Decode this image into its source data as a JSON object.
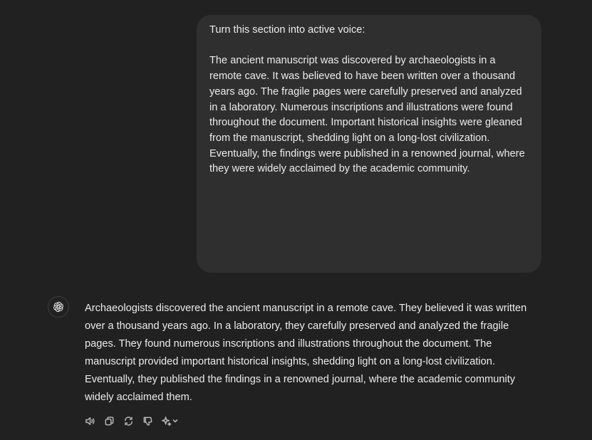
{
  "user_message": {
    "intro": "Turn this section into active voice:",
    "body": "The ancient manuscript was discovered by archaeologists in a remote cave. It was believed to have been written over a thousand years ago. The fragile pages were carefully preserved and analyzed in a laboratory. Numerous inscriptions and illustrations were found throughout the document. Important historical insights were gleaned from the manuscript, shedding light on a long-lost civilization. Eventually, the findings were published in a renowned journal, where they were widely acclaimed by the academic community."
  },
  "assistant_message": {
    "avatar_icon": "openai-logo-icon",
    "body": "Archaeologists discovered the ancient manuscript in a remote cave. They believed it was written over a thousand years ago. In a laboratory, they carefully preserved and analyzed the fragile pages. They found numerous inscriptions and illustrations throughout the document. The manuscript provided important historical insights, shedding light on a long-lost civilization. Eventually, they published the findings in a renowned journal, where the academic community widely acclaimed them."
  },
  "actions": [
    {
      "icon": "speaker-icon"
    },
    {
      "icon": "copy-icon"
    },
    {
      "icon": "regenerate-icon"
    },
    {
      "icon": "thumbs-down-icon"
    },
    {
      "icon": "sparkle-icon"
    }
  ],
  "colors": {
    "background": "#212121",
    "bubble": "#2f2f2f",
    "text": "#ececec",
    "icon": "#b4b4b4"
  }
}
